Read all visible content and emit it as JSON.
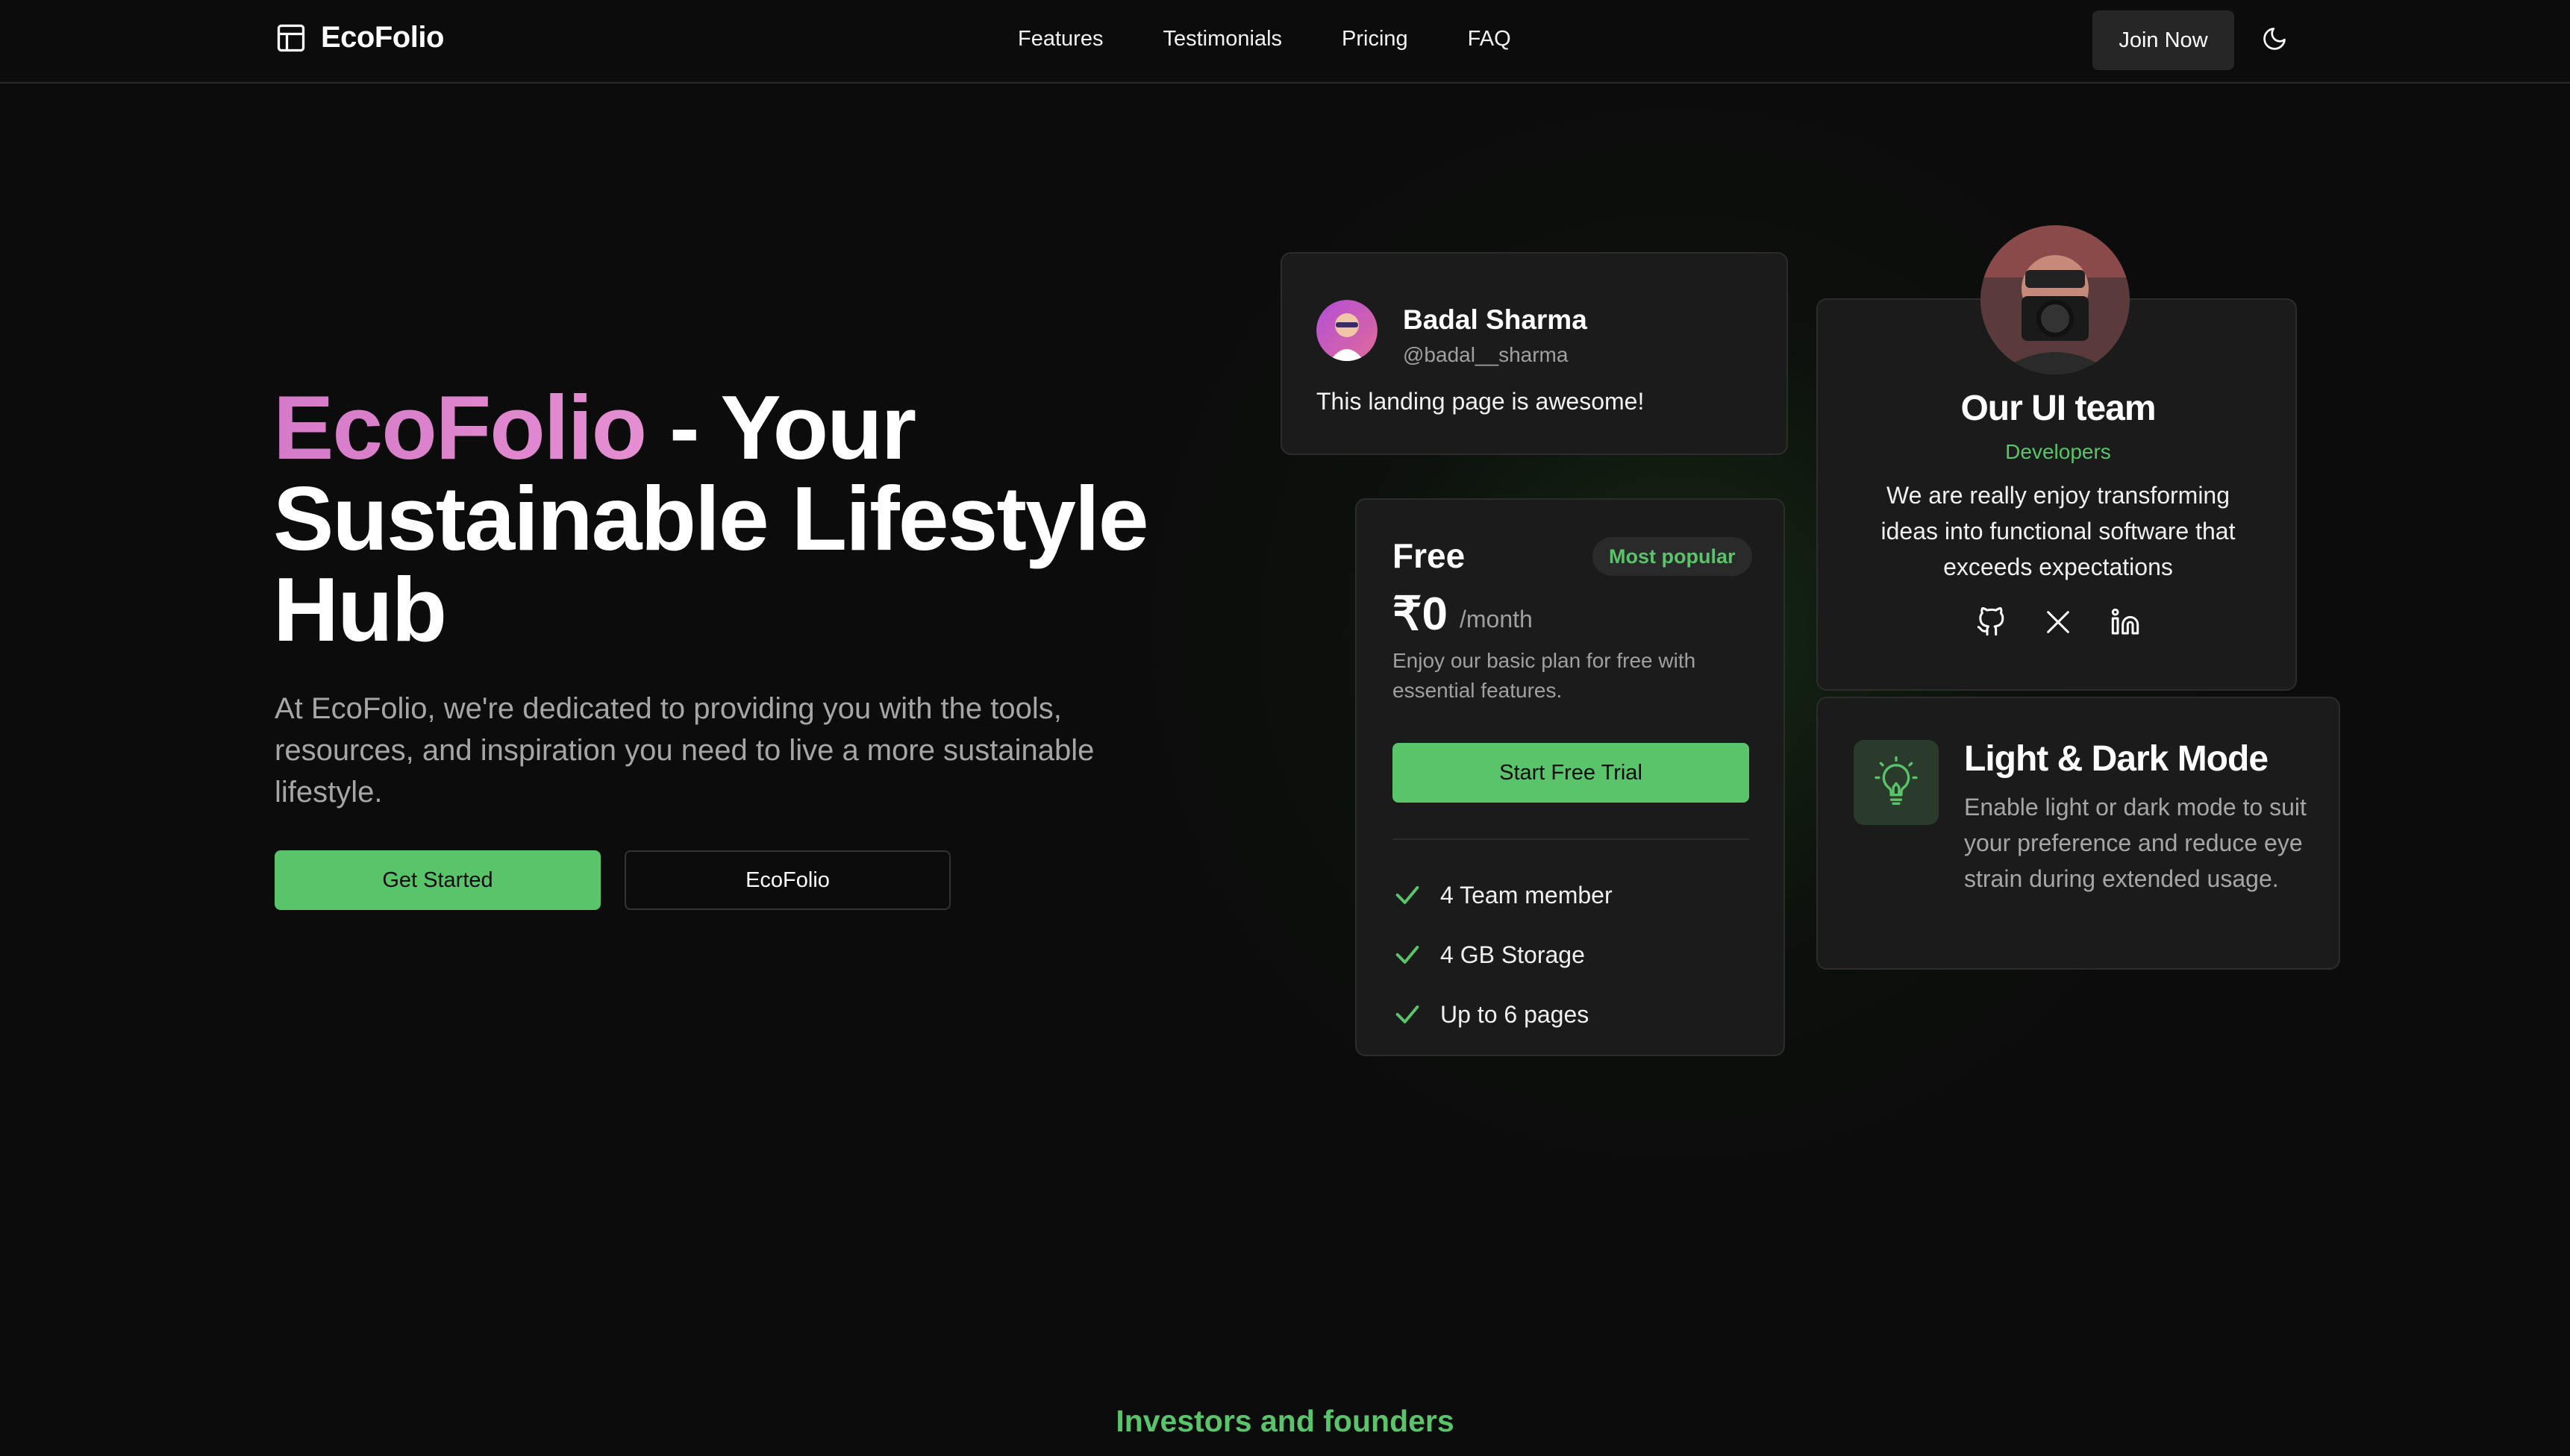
{
  "nav": {
    "brand": "EcoFolio",
    "links": [
      "Features",
      "Testimonials",
      "Pricing",
      "FAQ"
    ],
    "join_label": "Join Now",
    "theme_icon": "moon-icon"
  },
  "hero": {
    "title_highlight": "EcoFolio",
    "title_rest": " - Your Sustainable Lifestyle Hub",
    "description": "At EcoFolio, we're dedicated to providing you with the tools, resources, and inspiration you need to live a more sustainable lifestyle.",
    "primary_button": "Get Started",
    "secondary_button": "EcoFolio"
  },
  "testimonial": {
    "name": "Badal Sharma",
    "handle": "@badal__sharma",
    "quote": "This landing page is awesome!"
  },
  "pricing": {
    "plan": "Free",
    "badge": "Most popular",
    "price": "₹0",
    "period": "/month",
    "description": "Enjoy our basic plan for free with essential features.",
    "cta": "Start Free Trial",
    "features": [
      "4 Team member",
      "4 GB Storage",
      "Up to 6 pages"
    ]
  },
  "team": {
    "title": "Our UI team",
    "subtitle": "Developers",
    "description": "We are really enjoy transforming ideas into functional software that exceeds expectations",
    "socials": [
      "github-icon",
      "x-icon",
      "linkedin-icon"
    ]
  },
  "mode_card": {
    "title": "Light & Dark Mode",
    "description": "Enable light or dark mode to suit your preference and reduce eye strain during extended usage."
  },
  "investors_heading": "Investors and founders",
  "colors": {
    "accent_green": "#59c46a",
    "brand_pink": "#d57ac8",
    "background": "#0c0c0c",
    "card": "#1b1b1b"
  }
}
